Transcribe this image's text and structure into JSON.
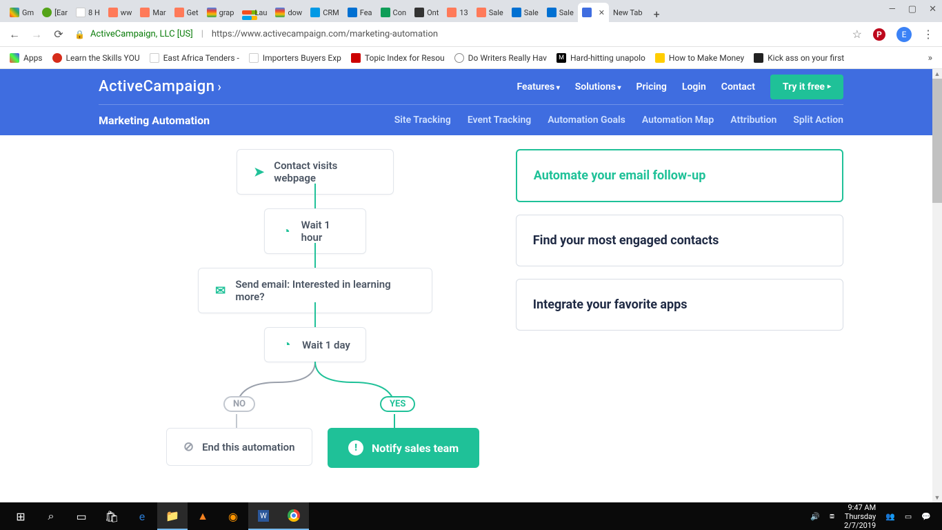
{
  "browser": {
    "tabs": [
      {
        "label": "Gm"
      },
      {
        "label": "[Ear"
      },
      {
        "label": "8 H"
      },
      {
        "label": "ww"
      },
      {
        "label": "Mar"
      },
      {
        "label": "Get"
      },
      {
        "label": "grap"
      },
      {
        "label": "Lau"
      },
      {
        "label": "dow"
      },
      {
        "label": "CRM"
      },
      {
        "label": "Fea"
      },
      {
        "label": "Con"
      },
      {
        "label": "Ont"
      },
      {
        "label": "13"
      },
      {
        "label": "Sale"
      },
      {
        "label": "Sale"
      },
      {
        "label": "Sale"
      },
      {
        "label": ""
      },
      {
        "label": "New Tab"
      }
    ],
    "url_host": "ActiveCampaign, LLC [US]",
    "url_path": "https://www.activecampaign.com/marketing-automation",
    "avatar_letter": "E"
  },
  "bookmarks": [
    {
      "label": "Apps"
    },
    {
      "label": "Learn the Skills YOU"
    },
    {
      "label": "East Africa Tenders -"
    },
    {
      "label": "Importers Buyers Exp"
    },
    {
      "label": "Topic Index for Resou"
    },
    {
      "label": "Do Writers Really Hav"
    },
    {
      "label": "Hard-hitting unapolo"
    },
    {
      "label": "How to Make Money"
    },
    {
      "label": "Kick ass on your first"
    }
  ],
  "header": {
    "logo": "ActiveCampaign",
    "nav": {
      "features": "Features",
      "solutions": "Solutions",
      "pricing": "Pricing",
      "login": "Login",
      "contact": "Contact",
      "cta": "Try it free"
    },
    "page_title": "Marketing Automation",
    "subnav": [
      "Site Tracking",
      "Event Tracking",
      "Automation Goals",
      "Automation Map",
      "Attribution",
      "Split Action"
    ]
  },
  "flow": {
    "step1": "Contact visits webpage",
    "step2": "Wait 1 hour",
    "step3": "Send email: Interested in learning more?",
    "step4": "Wait 1 day",
    "no": "NO",
    "yes": "YES",
    "end": "End this automation",
    "notify": "Notify sales team"
  },
  "cards": [
    "Automate your email follow-up",
    "Find your most engaged contacts",
    "Integrate your favorite apps"
  ],
  "taskbar": {
    "time": "9:47 AM",
    "day": "Thursday",
    "date": "2/7/2019"
  }
}
